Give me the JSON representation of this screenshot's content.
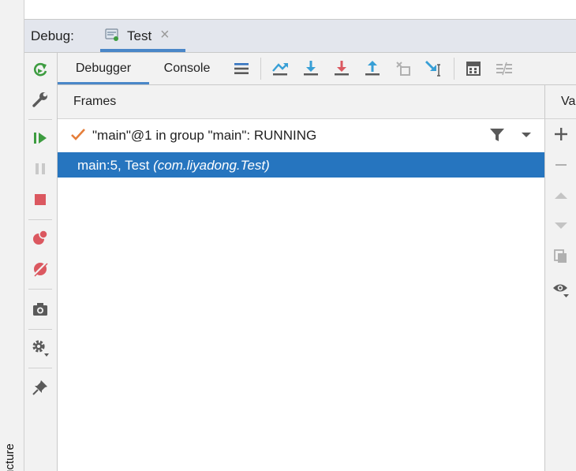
{
  "structure_label": "Structure",
  "debug_bar": {
    "label": "Debug:",
    "tab_name": "Test",
    "close_glyph": "×"
  },
  "view_tabs": [
    {
      "label": "Debugger",
      "active": true
    },
    {
      "label": "Console",
      "active": false
    }
  ],
  "frames": {
    "title": "Frames",
    "thread": "\"main\"@1 in group \"main\": RUNNING",
    "selected_frame": {
      "location": "main:5, Test ",
      "package": "(com.liyadong.Test)"
    }
  },
  "variables": {
    "title": "Va"
  },
  "colors": {
    "accent": "#4a87c8",
    "selection": "#2675bf",
    "green": "#3d9c40",
    "red": "#db5860",
    "blue": "#389fd6",
    "orange": "#e57e3a"
  },
  "icons": {
    "side_toolbar": [
      "rerun-icon",
      "settings-wrench-icon",
      "resume-icon",
      "pause-icon",
      "stop-icon",
      "view-breakpoints-icon",
      "mute-breakpoints-icon",
      "camera-icon",
      "gear-icon",
      "pin-icon"
    ],
    "main_toolbar": [
      "layout-menu-icon",
      "show-execution-point-icon",
      "step-over-icon",
      "step-into-icon",
      "force-step-into-icon",
      "step-out-icon",
      "drop-frame-icon",
      "run-to-cursor-icon",
      "evaluate-expression-icon",
      "trace-icon"
    ],
    "variables_toolbar": [
      "add-icon",
      "remove-icon",
      "move-up-icon",
      "move-down-icon",
      "copy-icon",
      "watch-icon"
    ]
  }
}
